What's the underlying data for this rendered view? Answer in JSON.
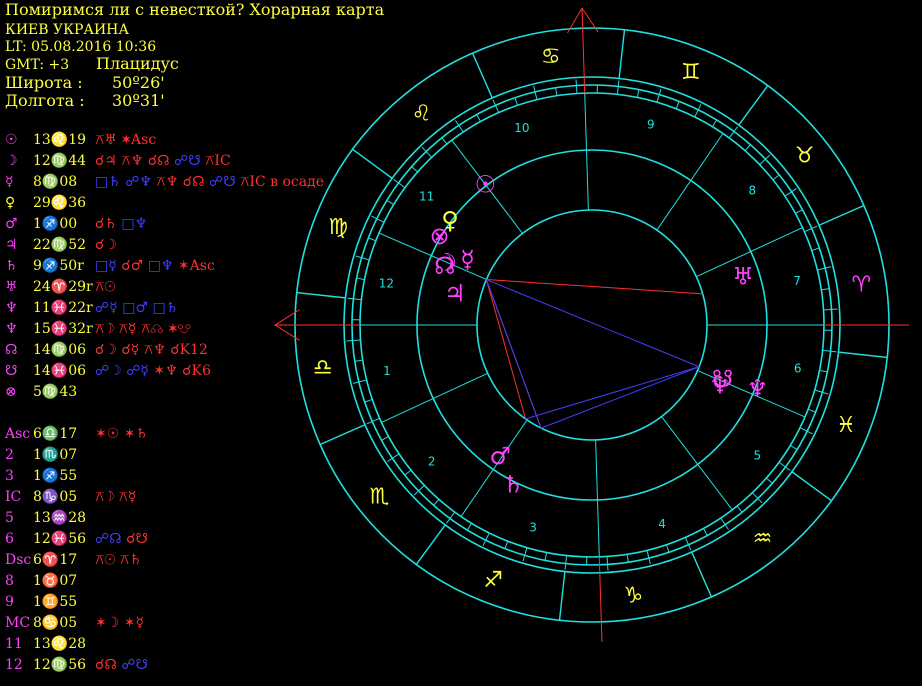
{
  "header": {
    "title": "Помиримся ли с невесткой? Хорарная карта",
    "place": "КИЕВ УКРАИНА",
    "lt": "LT: 05.08.2016  10:36",
    "gmt": "GMT: +3",
    "house_system": "Плацидус",
    "lat_label": "Широта :",
    "lat_value": "50º26'",
    "lon_label": "Долгота :",
    "lon_value": "30º31'"
  },
  "planets": [
    {
      "sym": "☉",
      "pos": "13♌19",
      "aspects": [
        {
          "t": "⚻♅",
          "c": "r"
        },
        {
          "t": "✶Asc",
          "c": "r"
        }
      ]
    },
    {
      "sym": "☽",
      "pos": "12♍44",
      "aspects": [
        {
          "t": "☌♃",
          "c": "r"
        },
        {
          "t": "⚻♆",
          "c": "r"
        },
        {
          "t": "☌☊",
          "c": "r"
        },
        {
          "t": "☍☋",
          "c": "b"
        },
        {
          "t": "⚻IC",
          "c": "r"
        }
      ]
    },
    {
      "sym": "☿",
      "pos": "8♍08",
      "aspects": [
        {
          "t": "□♄",
          "c": "b"
        },
        {
          "t": "☍♆",
          "c": "b"
        },
        {
          "t": "⚻♆",
          "c": "r"
        },
        {
          "t": "☌☊",
          "c": "r"
        },
        {
          "t": "☍☋",
          "c": "b"
        },
        {
          "t": "⚻IC в осаде",
          "c": "r"
        }
      ]
    },
    {
      "sym": "♀",
      "pos": "29♌36",
      "aspects": []
    },
    {
      "sym": "♂",
      "pos": "1♐00",
      "aspects": [
        {
          "t": "☌♄",
          "c": "r"
        },
        {
          "t": "□♆",
          "c": "b"
        }
      ]
    },
    {
      "sym": "♃",
      "pos": "22♍52",
      "aspects": [
        {
          "t": "☌☽",
          "c": "r"
        }
      ]
    },
    {
      "sym": "♄",
      "pos": "9♐50r",
      "aspects": [
        {
          "t": "□☿",
          "c": "b"
        },
        {
          "t": "☌♂",
          "c": "r"
        },
        {
          "t": "□♆",
          "c": "b"
        },
        {
          "t": "✶Asc",
          "c": "r"
        }
      ]
    },
    {
      "sym": "♅",
      "pos": "24♈29r",
      "aspects": [
        {
          "t": "⚻☉",
          "c": "r"
        }
      ]
    },
    {
      "sym": "♆",
      "pos": "11♓22r",
      "aspects": [
        {
          "t": "☍☿",
          "c": "b"
        },
        {
          "t": "□♂",
          "c": "b"
        },
        {
          "t": "□♄",
          "c": "b"
        }
      ]
    },
    {
      "sym": "♆",
      "pos": "15♓32r",
      "aspects": [
        {
          "t": "⚻☽",
          "c": "r"
        },
        {
          "t": "⚻☿",
          "c": "r"
        },
        {
          "t": "⚻☊",
          "c": "r"
        },
        {
          "t": "✶☋",
          "c": "r"
        }
      ]
    },
    {
      "sym": "☊",
      "pos": "14♍06",
      "aspects": [
        {
          "t": "☌☽",
          "c": "r"
        },
        {
          "t": "☌☿",
          "c": "r"
        },
        {
          "t": "⚻♆",
          "c": "r"
        },
        {
          "t": "☌K12",
          "c": "r"
        }
      ]
    },
    {
      "sym": "☋",
      "pos": "14♓06",
      "aspects": [
        {
          "t": "☍☽",
          "c": "b"
        },
        {
          "t": "☍☿",
          "c": "b"
        },
        {
          "t": "✶♆",
          "c": "r"
        },
        {
          "t": "☌K6",
          "c": "r"
        }
      ]
    },
    {
      "sym": "⊗",
      "pos": "5♍43",
      "aspects": []
    }
  ],
  "houses": [
    {
      "label": "Asc",
      "pos": "6♎17",
      "aspects": [
        {
          "t": "✶☉",
          "c": "r"
        },
        {
          "t": "✶♄",
          "c": "r"
        }
      ]
    },
    {
      "label": "2",
      "pos": "1♏07",
      "aspects": []
    },
    {
      "label": "3",
      "pos": "1♐55",
      "aspects": []
    },
    {
      "label": "IC",
      "pos": "8♑05",
      "aspects": [
        {
          "t": "⚻☽",
          "c": "r"
        },
        {
          "t": "⚻☿",
          "c": "r"
        }
      ]
    },
    {
      "label": "5",
      "pos": "13♒28",
      "aspects": []
    },
    {
      "label": "6",
      "pos": "12♓56",
      "aspects": [
        {
          "t": "☍☊",
          "c": "b"
        },
        {
          "t": "☌☋",
          "c": "r"
        }
      ]
    },
    {
      "label": "Dsc",
      "pos": "6♈17",
      "aspects": [
        {
          "t": "⚻☉",
          "c": "r"
        },
        {
          "t": "⚻♄",
          "c": "r"
        }
      ]
    },
    {
      "label": "8",
      "pos": "1♉07",
      "aspects": []
    },
    {
      "label": "9",
      "pos": "1♊55",
      "aspects": []
    },
    {
      "label": "MC",
      "pos": "8♋05",
      "aspects": [
        {
          "t": "✶☽",
          "c": "r"
        },
        {
          "t": "✶☿",
          "c": "r"
        }
      ]
    },
    {
      "label": "11",
      "pos": "13♌28",
      "aspects": []
    },
    {
      "label": "12",
      "pos": "12♍56",
      "aspects": [
        {
          "t": "☌☊",
          "c": "r"
        },
        {
          "t": "☍☋",
          "c": "b"
        }
      ]
    }
  ],
  "wheel": {
    "colors": {
      "ring": "#20e0e0",
      "yellow": "#ffff40",
      "magenta": "#ff40ff",
      "red": "#ff3030",
      "blue": "#4040ff"
    },
    "asc_longitude": 186.28,
    "signs": [
      {
        "glyph": "♈",
        "lon": 0,
        "color": "magenta"
      },
      {
        "glyph": "♉",
        "lon": 30,
        "color": "yellow"
      },
      {
        "glyph": "♊",
        "lon": 60,
        "color": "yellow"
      },
      {
        "glyph": "♋",
        "lon": 90,
        "color": "yellow"
      },
      {
        "glyph": "♌",
        "lon": 120,
        "color": "yellow"
      },
      {
        "glyph": "♍",
        "lon": 150,
        "color": "yellow"
      },
      {
        "glyph": "♎",
        "lon": 180,
        "color": "yellow"
      },
      {
        "glyph": "♏",
        "lon": 210,
        "color": "yellow"
      },
      {
        "glyph": "♐",
        "lon": 240,
        "color": "yellow"
      },
      {
        "glyph": "♑",
        "lon": 270,
        "color": "yellow"
      },
      {
        "glyph": "♒",
        "lon": 300,
        "color": "yellow"
      },
      {
        "glyph": "♓",
        "lon": 330,
        "color": "yellow"
      }
    ],
    "cusps": [
      186.28,
      211.12,
      241.92,
      278.08,
      313.47,
      342.93,
      6.28,
      31.12,
      61.92,
      98.08,
      133.47,
      162.93
    ],
    "house_numbers": [
      "1",
      "2",
      "3",
      "4",
      "5",
      "6",
      "7",
      "8",
      "9",
      "10",
      "11",
      "12"
    ],
    "bodies": [
      {
        "glyph": "☉",
        "lon": 133.32,
        "color": "magenta"
      },
      {
        "glyph": "☽",
        "lon": 162.73,
        "color": "magenta"
      },
      {
        "glyph": "☿",
        "lon": 158.13,
        "color": "magenta"
      },
      {
        "glyph": "♀",
        "lon": 149.6,
        "color": "yellow"
      },
      {
        "glyph": "♂",
        "lon": 241.0,
        "color": "magenta"
      },
      {
        "glyph": "♃",
        "lon": 172.87,
        "color": "magenta"
      },
      {
        "glyph": "♄",
        "lon": 249.83,
        "color": "magenta"
      },
      {
        "glyph": "♅",
        "lon": 24.48,
        "color": "magenta"
      },
      {
        "glyph": "♆",
        "lon": 341.37,
        "color": "magenta"
      },
      {
        "glyph": "♆",
        "lon": 345.53,
        "color": "magenta"
      },
      {
        "glyph": "☊",
        "lon": 164.1,
        "color": "magenta"
      },
      {
        "glyph": "☋",
        "lon": 344.1,
        "color": "magenta"
      },
      {
        "glyph": "⊗",
        "lon": 155.72,
        "color": "magenta"
      }
    ],
    "aspect_lines": [
      {
        "from": 163,
        "to": 22,
        "color": "red"
      },
      {
        "from": 163,
        "to": 250,
        "color": "red"
      },
      {
        "from": 163,
        "to": 241,
        "color": "red"
      },
      {
        "from": 163,
        "to": 250,
        "color": "blue"
      },
      {
        "from": 163,
        "to": 345,
        "color": "blue"
      },
      {
        "from": 250,
        "to": 345,
        "color": "blue"
      },
      {
        "from": 241,
        "to": 345,
        "color": "blue"
      }
    ]
  }
}
